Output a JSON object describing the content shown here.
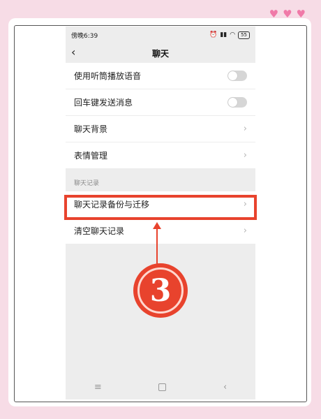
{
  "status_bar": {
    "time": "傍晚6:39",
    "battery": "55"
  },
  "header": {
    "back_icon": "chevron-left-icon",
    "title": "聊天"
  },
  "settings": {
    "use_earpiece": "使用听筒播放语音",
    "enter_send": "回车键发送消息",
    "chat_background": "聊天背景",
    "sticker_management": "表情管理"
  },
  "section_label": "聊天记录",
  "records": {
    "backup_migrate": "聊天记录备份与迁移",
    "clear_history": "清空聊天记录"
  },
  "annotation": {
    "step_number": "3",
    "accent_color": "#e8432d"
  },
  "toggles": {
    "use_earpiece_on": false,
    "enter_send_on": false
  }
}
